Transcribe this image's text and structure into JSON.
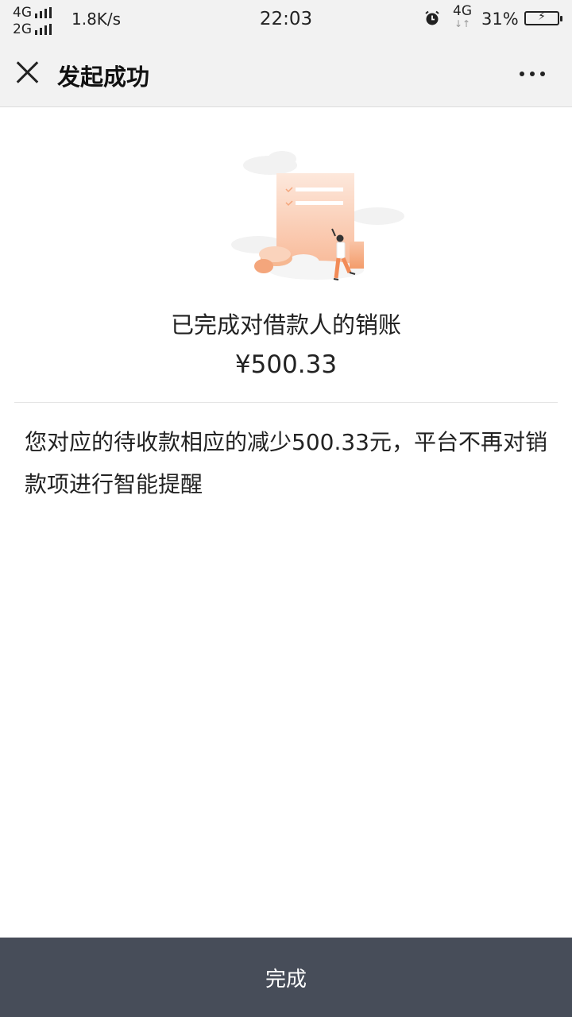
{
  "status_bar": {
    "network_top": "4G",
    "network_bottom": "2G",
    "speed": "1.8K/s",
    "time": "22:03",
    "network_right": "4G",
    "battery": "31%"
  },
  "header": {
    "title": "发起成功"
  },
  "result": {
    "title": "已完成对借款人的销账",
    "amount": "¥500.33",
    "description": "您对应的待收款相应的减少500.33元，平台不再对销款项进行智能提醒"
  },
  "footer": {
    "done_label": "完成"
  },
  "colors": {
    "accent": "#f28b57",
    "button_bg": "#474d59",
    "header_bg": "#f2f2f2"
  }
}
